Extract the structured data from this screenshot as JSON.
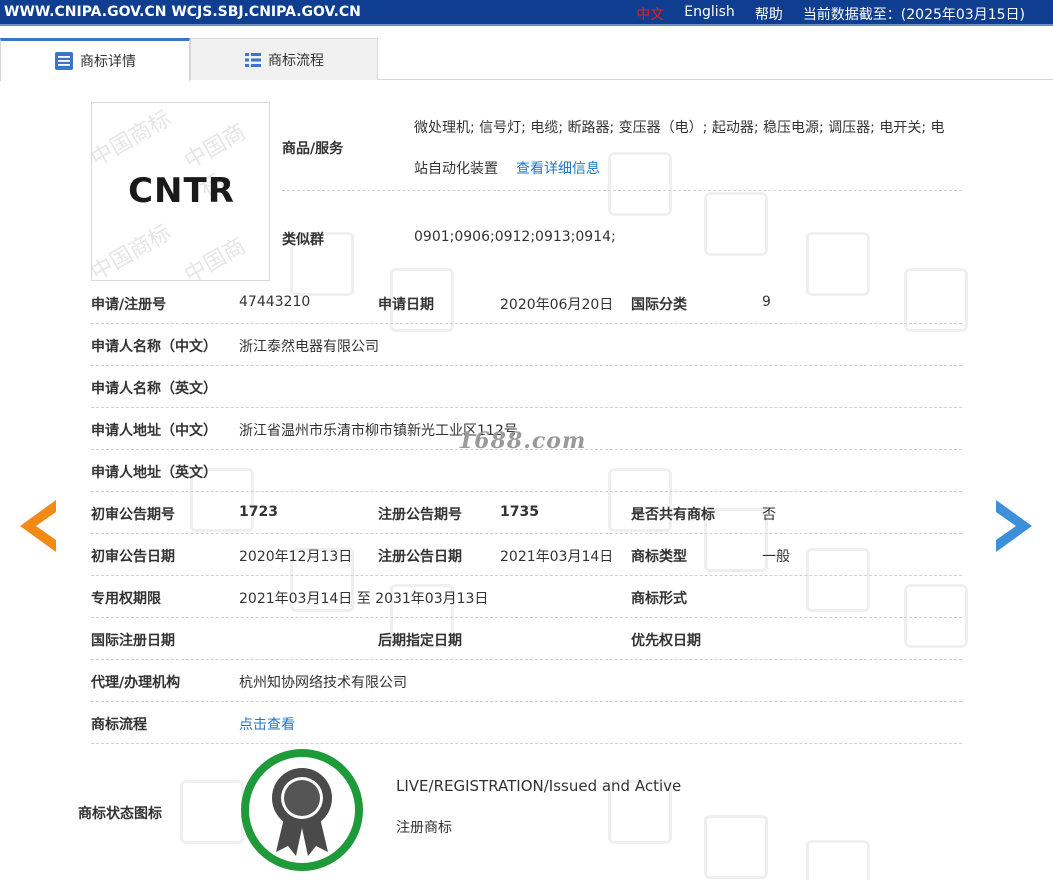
{
  "topbar": {
    "domains": "WWW.CNIPA.GOV.CN WCJS.SBJ.CNIPA.GOV.CN",
    "lang_zh": "中文",
    "lang_en": "English",
    "help": "帮助",
    "data_date": "当前数据截至：(2025年03月15日)"
  },
  "tabs": [
    {
      "label": "商标详情",
      "icon": "document-list-icon"
    },
    {
      "label": "商标流程",
      "icon": "list-icon"
    }
  ],
  "mark": {
    "text": "CNTR",
    "watermark": "中国商标"
  },
  "goods": {
    "label": "商品/服务",
    "line1": "微处理机; 信号灯; 电缆; 断路器; 变压器（电）; 起动器; 稳压电源; 调压器; 电开关; 电",
    "line2": "站自动化装置",
    "detail_link": "查看详细信息"
  },
  "similar": {
    "label": "类似群",
    "value": "0901;0906;0912;0913;0914;"
  },
  "rows": {
    "reg_no_label": "申请/注册号",
    "reg_no": "47443210",
    "app_date_label": "申请日期",
    "app_date": "2020年06月20日",
    "intl_class_label": "国际分类",
    "intl_class": "9",
    "applicant_cn_label": "申请人名称（中文）",
    "applicant_cn": "浙江泰然电器有限公司",
    "applicant_en_label": "申请人名称（英文）",
    "address_cn_label": "申请人地址（中文）",
    "address_cn": "浙江省温州市乐清市柳市镇新光工业区112号",
    "address_en_label": "申请人地址（英文）",
    "prelim_no_label": "初审公告期号",
    "prelim_no": "1723",
    "reg_pub_no_label": "注册公告期号",
    "reg_pub_no": "1735",
    "shared_label": "是否共有商标",
    "shared": "否",
    "prelim_date_label": "初审公告日期",
    "prelim_date": "2020年12月13日",
    "reg_pub_date_label": "注册公告日期",
    "reg_pub_date": "2021年03月14日",
    "type_label": "商标类型",
    "type": "一般",
    "period_label": "专用权期限",
    "period": "2021年03月14日 至 2031年03月13日",
    "form_label": "商标形式",
    "intl_reg_date_label": "国际注册日期",
    "later_date_label": "后期指定日期",
    "priority_label": "优先权日期",
    "agent_label": "代理/办理机构",
    "agent": "杭州知协网络技术有限公司",
    "process_label": "商标流程",
    "process_link": "点击查看",
    "status_label": "商标状态图标",
    "status_en": "LIVE/REGISTRATION/Issued and Active",
    "status_cn": "注册商标"
  },
  "overlay": "1688.com",
  "colors": {
    "topbar": "#0f3d8f",
    "link": "#1f79c8",
    "prev_arrow": "#f28a16",
    "next_arrow": "#3c8fd8",
    "status_ring": "#1f9a3a"
  }
}
